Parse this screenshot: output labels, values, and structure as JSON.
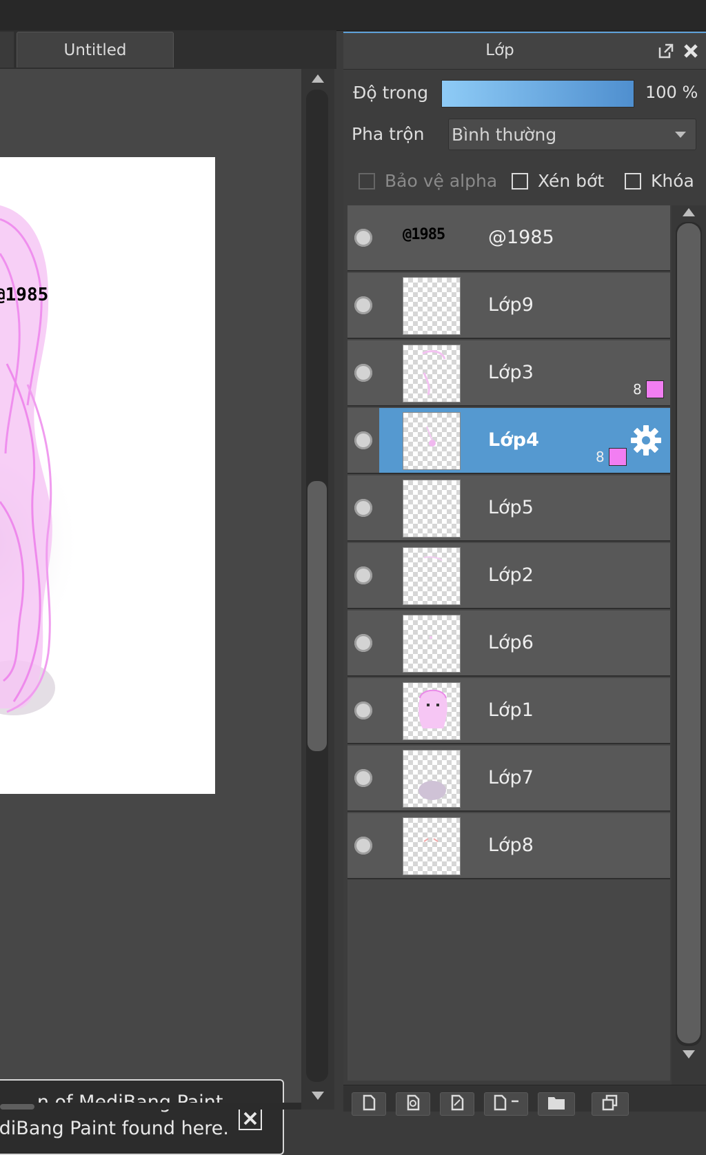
{
  "document_tab": {
    "title": "Untitled"
  },
  "canvas": {
    "watermark_text": "@1985"
  },
  "notification": {
    "line1": "n of MediBang Paint.",
    "line2": "diBang Paint found here."
  },
  "layer_panel": {
    "title": "Lớp",
    "opacity": {
      "label": "Độ trong",
      "value_text": "100 %",
      "value": 100,
      "bar_color": "#5ea6e0"
    },
    "blend": {
      "label": "Pha trộn",
      "value": "Bình thường"
    },
    "checks": {
      "alpha_protect": "Bảo vệ alpha",
      "clipping": "Xén bớt",
      "lock": "Khóa"
    },
    "layers": [
      {
        "name": "@1985",
        "thumb_text": "@1985",
        "selected": false
      },
      {
        "name": "Lớp9",
        "selected": false
      },
      {
        "name": "Lớp3",
        "badge": "8",
        "selected": false
      },
      {
        "name": "Lớp4",
        "badge": "8",
        "selected": true
      },
      {
        "name": "Lớp5",
        "selected": false
      },
      {
        "name": "Lớp2",
        "selected": false
      },
      {
        "name": "Lớp6",
        "selected": false
      },
      {
        "name": "Lớp1",
        "selected": false
      },
      {
        "name": "Lớp7",
        "selected": false
      },
      {
        "name": "Lớp8",
        "selected": false
      }
    ],
    "selection_color": "#5599d0",
    "badge_color": "#f27ef2"
  }
}
